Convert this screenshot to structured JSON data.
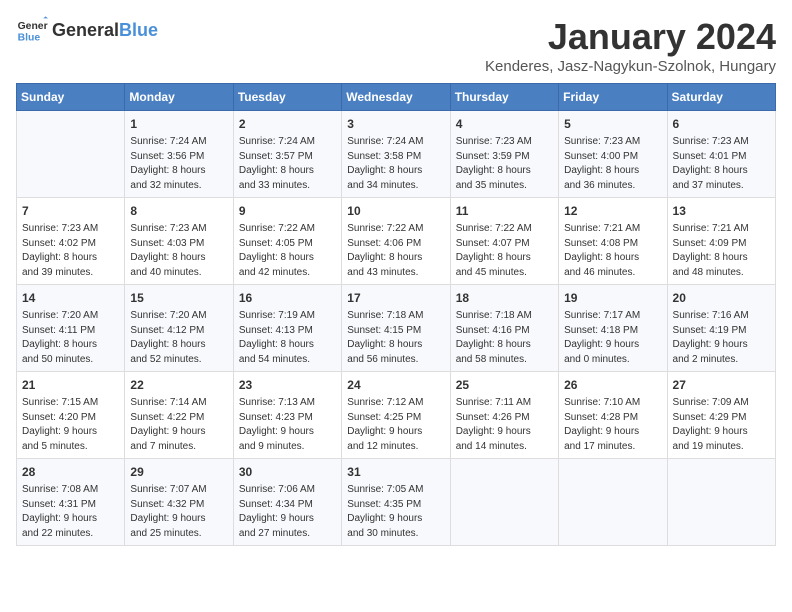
{
  "logo": {
    "general": "General",
    "blue": "Blue"
  },
  "title": "January 2024",
  "location": "Kenderes, Jasz-Nagykun-Szolnok, Hungary",
  "days_of_week": [
    "Sunday",
    "Monday",
    "Tuesday",
    "Wednesday",
    "Thursday",
    "Friday",
    "Saturday"
  ],
  "weeks": [
    [
      {
        "day": "",
        "info": ""
      },
      {
        "day": "1",
        "info": "Sunrise: 7:24 AM\nSunset: 3:56 PM\nDaylight: 8 hours\nand 32 minutes."
      },
      {
        "day": "2",
        "info": "Sunrise: 7:24 AM\nSunset: 3:57 PM\nDaylight: 8 hours\nand 33 minutes."
      },
      {
        "day": "3",
        "info": "Sunrise: 7:24 AM\nSunset: 3:58 PM\nDaylight: 8 hours\nand 34 minutes."
      },
      {
        "day": "4",
        "info": "Sunrise: 7:23 AM\nSunset: 3:59 PM\nDaylight: 8 hours\nand 35 minutes."
      },
      {
        "day": "5",
        "info": "Sunrise: 7:23 AM\nSunset: 4:00 PM\nDaylight: 8 hours\nand 36 minutes."
      },
      {
        "day": "6",
        "info": "Sunrise: 7:23 AM\nSunset: 4:01 PM\nDaylight: 8 hours\nand 37 minutes."
      }
    ],
    [
      {
        "day": "7",
        "info": "Sunrise: 7:23 AM\nSunset: 4:02 PM\nDaylight: 8 hours\nand 39 minutes."
      },
      {
        "day": "8",
        "info": "Sunrise: 7:23 AM\nSunset: 4:03 PM\nDaylight: 8 hours\nand 40 minutes."
      },
      {
        "day": "9",
        "info": "Sunrise: 7:22 AM\nSunset: 4:05 PM\nDaylight: 8 hours\nand 42 minutes."
      },
      {
        "day": "10",
        "info": "Sunrise: 7:22 AM\nSunset: 4:06 PM\nDaylight: 8 hours\nand 43 minutes."
      },
      {
        "day": "11",
        "info": "Sunrise: 7:22 AM\nSunset: 4:07 PM\nDaylight: 8 hours\nand 45 minutes."
      },
      {
        "day": "12",
        "info": "Sunrise: 7:21 AM\nSunset: 4:08 PM\nDaylight: 8 hours\nand 46 minutes."
      },
      {
        "day": "13",
        "info": "Sunrise: 7:21 AM\nSunset: 4:09 PM\nDaylight: 8 hours\nand 48 minutes."
      }
    ],
    [
      {
        "day": "14",
        "info": "Sunrise: 7:20 AM\nSunset: 4:11 PM\nDaylight: 8 hours\nand 50 minutes."
      },
      {
        "day": "15",
        "info": "Sunrise: 7:20 AM\nSunset: 4:12 PM\nDaylight: 8 hours\nand 52 minutes."
      },
      {
        "day": "16",
        "info": "Sunrise: 7:19 AM\nSunset: 4:13 PM\nDaylight: 8 hours\nand 54 minutes."
      },
      {
        "day": "17",
        "info": "Sunrise: 7:18 AM\nSunset: 4:15 PM\nDaylight: 8 hours\nand 56 minutes."
      },
      {
        "day": "18",
        "info": "Sunrise: 7:18 AM\nSunset: 4:16 PM\nDaylight: 8 hours\nand 58 minutes."
      },
      {
        "day": "19",
        "info": "Sunrise: 7:17 AM\nSunset: 4:18 PM\nDaylight: 9 hours\nand 0 minutes."
      },
      {
        "day": "20",
        "info": "Sunrise: 7:16 AM\nSunset: 4:19 PM\nDaylight: 9 hours\nand 2 minutes."
      }
    ],
    [
      {
        "day": "21",
        "info": "Sunrise: 7:15 AM\nSunset: 4:20 PM\nDaylight: 9 hours\nand 5 minutes."
      },
      {
        "day": "22",
        "info": "Sunrise: 7:14 AM\nSunset: 4:22 PM\nDaylight: 9 hours\nand 7 minutes."
      },
      {
        "day": "23",
        "info": "Sunrise: 7:13 AM\nSunset: 4:23 PM\nDaylight: 9 hours\nand 9 minutes."
      },
      {
        "day": "24",
        "info": "Sunrise: 7:12 AM\nSunset: 4:25 PM\nDaylight: 9 hours\nand 12 minutes."
      },
      {
        "day": "25",
        "info": "Sunrise: 7:11 AM\nSunset: 4:26 PM\nDaylight: 9 hours\nand 14 minutes."
      },
      {
        "day": "26",
        "info": "Sunrise: 7:10 AM\nSunset: 4:28 PM\nDaylight: 9 hours\nand 17 minutes."
      },
      {
        "day": "27",
        "info": "Sunrise: 7:09 AM\nSunset: 4:29 PM\nDaylight: 9 hours\nand 19 minutes."
      }
    ],
    [
      {
        "day": "28",
        "info": "Sunrise: 7:08 AM\nSunset: 4:31 PM\nDaylight: 9 hours\nand 22 minutes."
      },
      {
        "day": "29",
        "info": "Sunrise: 7:07 AM\nSunset: 4:32 PM\nDaylight: 9 hours\nand 25 minutes."
      },
      {
        "day": "30",
        "info": "Sunrise: 7:06 AM\nSunset: 4:34 PM\nDaylight: 9 hours\nand 27 minutes."
      },
      {
        "day": "31",
        "info": "Sunrise: 7:05 AM\nSunset: 4:35 PM\nDaylight: 9 hours\nand 30 minutes."
      },
      {
        "day": "",
        "info": ""
      },
      {
        "day": "",
        "info": ""
      },
      {
        "day": "",
        "info": ""
      }
    ]
  ]
}
